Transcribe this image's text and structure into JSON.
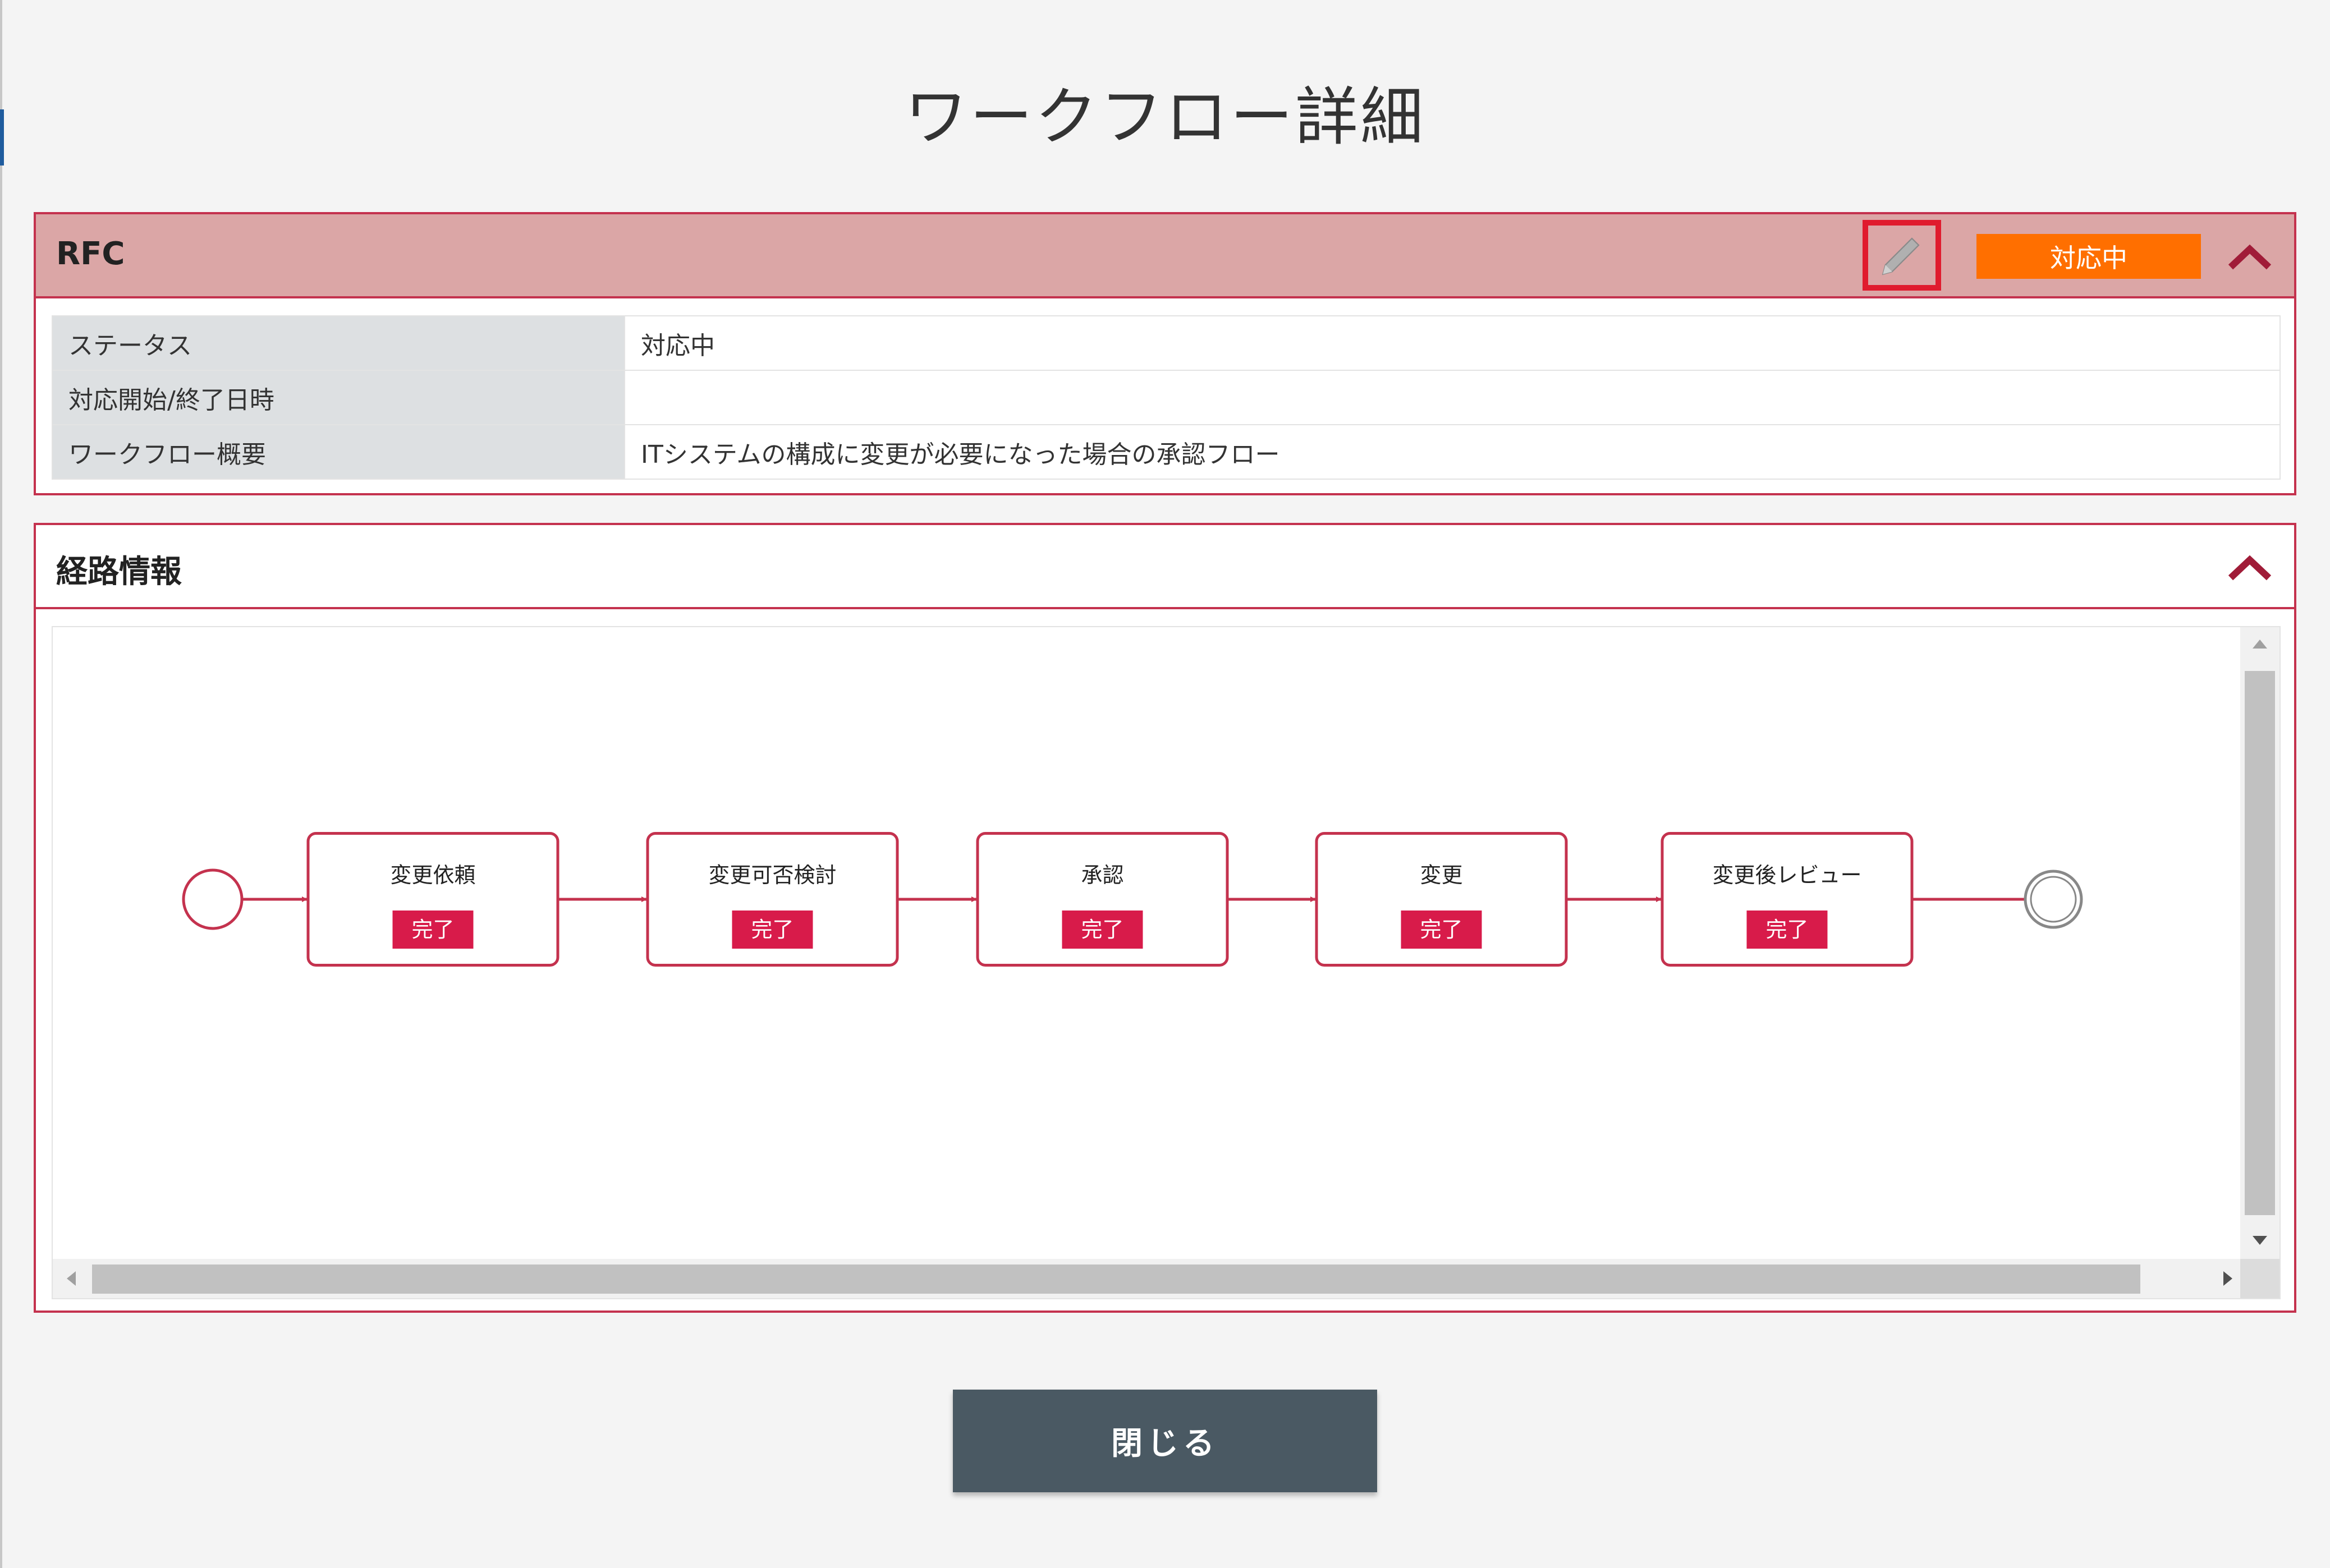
{
  "page": {
    "title": "ワークフロー詳細"
  },
  "rfc_panel": {
    "title": "RFC",
    "edit_icon": "pencil-icon",
    "status_badge": "対応中",
    "status_badge_color": "#ff6f00",
    "collapse_icon": "chevron-up-icon",
    "rows": [
      {
        "key": "ステータス",
        "value": "対応中"
      },
      {
        "key": "対応開始/終了日時",
        "value": ""
      },
      {
        "key": "ワークフロー概要",
        "value": "ITシステムの構成に変更が必要になった場合の承認フロー"
      }
    ]
  },
  "route_panel": {
    "title": "経路情報",
    "collapse_icon": "chevron-up-icon",
    "flow": {
      "start_event": "start-circle",
      "end_event": "end-circle",
      "steps": [
        {
          "name": "変更依頼",
          "status": "完了"
        },
        {
          "name": "変更可否検討",
          "status": "完了"
        },
        {
          "name": "承認",
          "status": "完了"
        },
        {
          "name": "変更",
          "status": "完了"
        },
        {
          "name": "変更後レビュー",
          "status": "完了"
        }
      ]
    }
  },
  "colors": {
    "accent": "#c4324e",
    "header_bg": "#dba6a6",
    "status_chip": "#d81b4a",
    "close_button": "#4a5963"
  },
  "footer": {
    "close_label": "閉じる"
  }
}
